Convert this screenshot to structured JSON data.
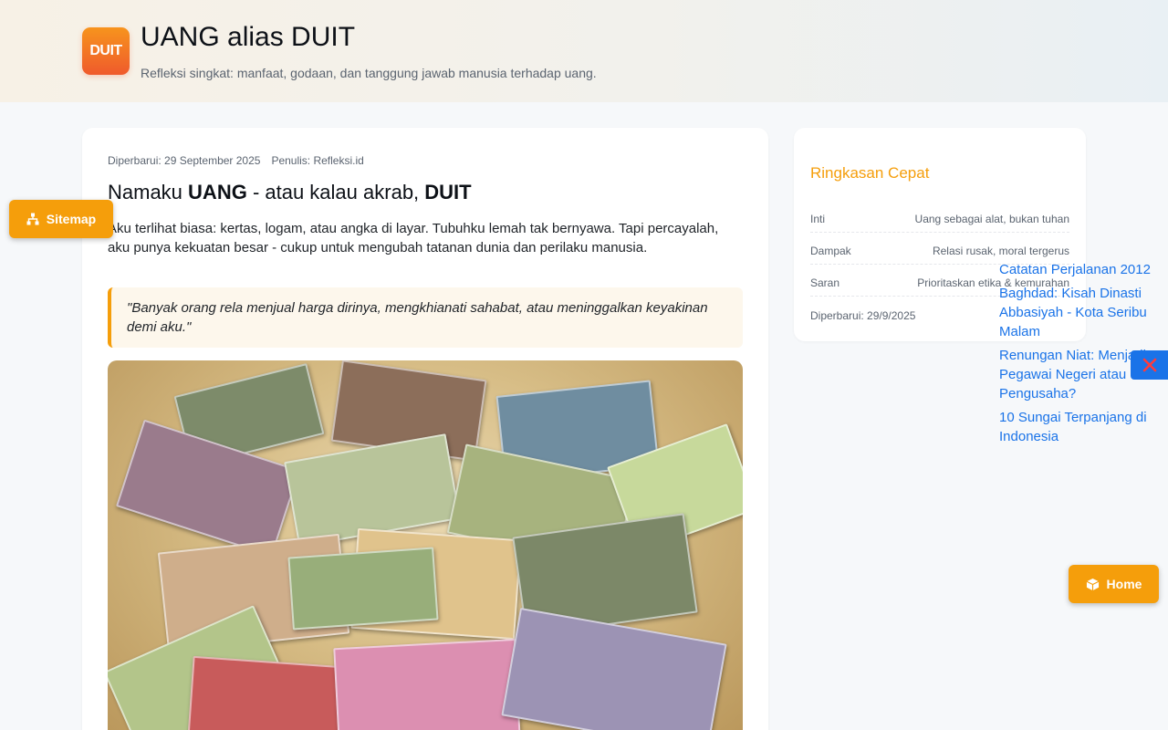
{
  "header": {
    "logo_text": "DUIT",
    "title": "UANG alias DUIT",
    "tagline": "Refleksi singkat: manfaat, godaan, dan tanggung jawab manusia terhadap uang."
  },
  "article": {
    "updated": "Diperbarui: 29 September 2025",
    "author": "Penulis: Refleksi.id",
    "heading": {
      "prefix": "Namaku ",
      "strong1": "UANG",
      "middle": " - atau kalau akrab, ",
      "strong2": "DUIT"
    },
    "lead": "Aku terlihat biasa: kertas, logam, atau angka di layar. Tubuhku lemah tak bernyawa. Tapi percayalah, aku punya kekuatan besar - cukup untuk mengubah tatanan dunia dan perilaku manusia.",
    "quote": "\"Banyak orang rela menjual harga dirinya, mengkhianati sahabat, atau meninggalkan keyakinan demi aku.\""
  },
  "sidebar": {
    "title": "Ringkasan Cepat",
    "rows": [
      {
        "key": "Inti",
        "value": "Uang sebagai alat, bukan tuhan"
      },
      {
        "key": "Dampak",
        "value": "Relasi rusak, moral tergerus"
      },
      {
        "key": "Saran",
        "value": "Prioritaskan etika & kemurahan"
      }
    ],
    "updated": "Diperbarui: 29/9/2025"
  },
  "float_links": [
    "Catatan Perjalanan 2012",
    "Baghdad: Kisah Dinasti Abbasiyah - Kota Seribu Malam",
    "Renungan Niat: Menjadi Pegawai Negeri atau Pengusaha?",
    "10 Sungai Terpanjang di Indonesia"
  ],
  "buttons": {
    "sitemap": "Sitemap",
    "home": "Home"
  },
  "icons": {
    "sitemap": "sitemap-icon",
    "home": "box-icon",
    "close": "close-icon"
  },
  "colors": {
    "accent": "#f59e0b",
    "link": "#1a73e8",
    "logo_top": "#f7941d",
    "logo_bottom": "#ef5a2c"
  }
}
